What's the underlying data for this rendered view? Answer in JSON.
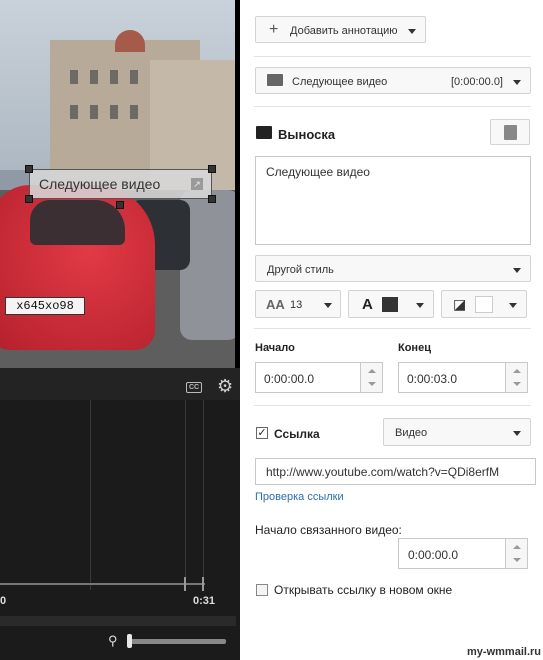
{
  "video": {
    "callout_text": "Следующее видео",
    "plate_text": "х645хо98"
  },
  "player": {
    "cc_label": "CC"
  },
  "timeline": {
    "start_label": "0",
    "end_label": "0:31"
  },
  "panel": {
    "add_annotation_label": "Добавить аннотацию",
    "annotation_select": {
      "name": "Следующее видео",
      "time": "[0:00:00.0]"
    },
    "section_title": "Выноска",
    "text_value": "Следующее видео",
    "style_select": "Другой стиль",
    "font_size": "13",
    "start_label": "Начало",
    "end_label": "Конец",
    "start_value": "0:00:00.0",
    "end_value": "0:00:03.0",
    "link_label": "Ссылка",
    "link_checked": true,
    "link_type": "Видео",
    "link_url": "http://www.youtube.com/watch?v=QDi8erfM",
    "check_link": "Проверка ссылки",
    "linked_start_label": "Начало связанного видео:",
    "linked_start_value": "0:00:00.0",
    "new_window_label": "Открывать ссылку в новом окне",
    "new_window_checked": false
  },
  "colors": {
    "text_color": "#333333",
    "bg_color": "#ffffff",
    "link_color": "#2a6fb0"
  },
  "watermark": "my-wmmail.ru"
}
